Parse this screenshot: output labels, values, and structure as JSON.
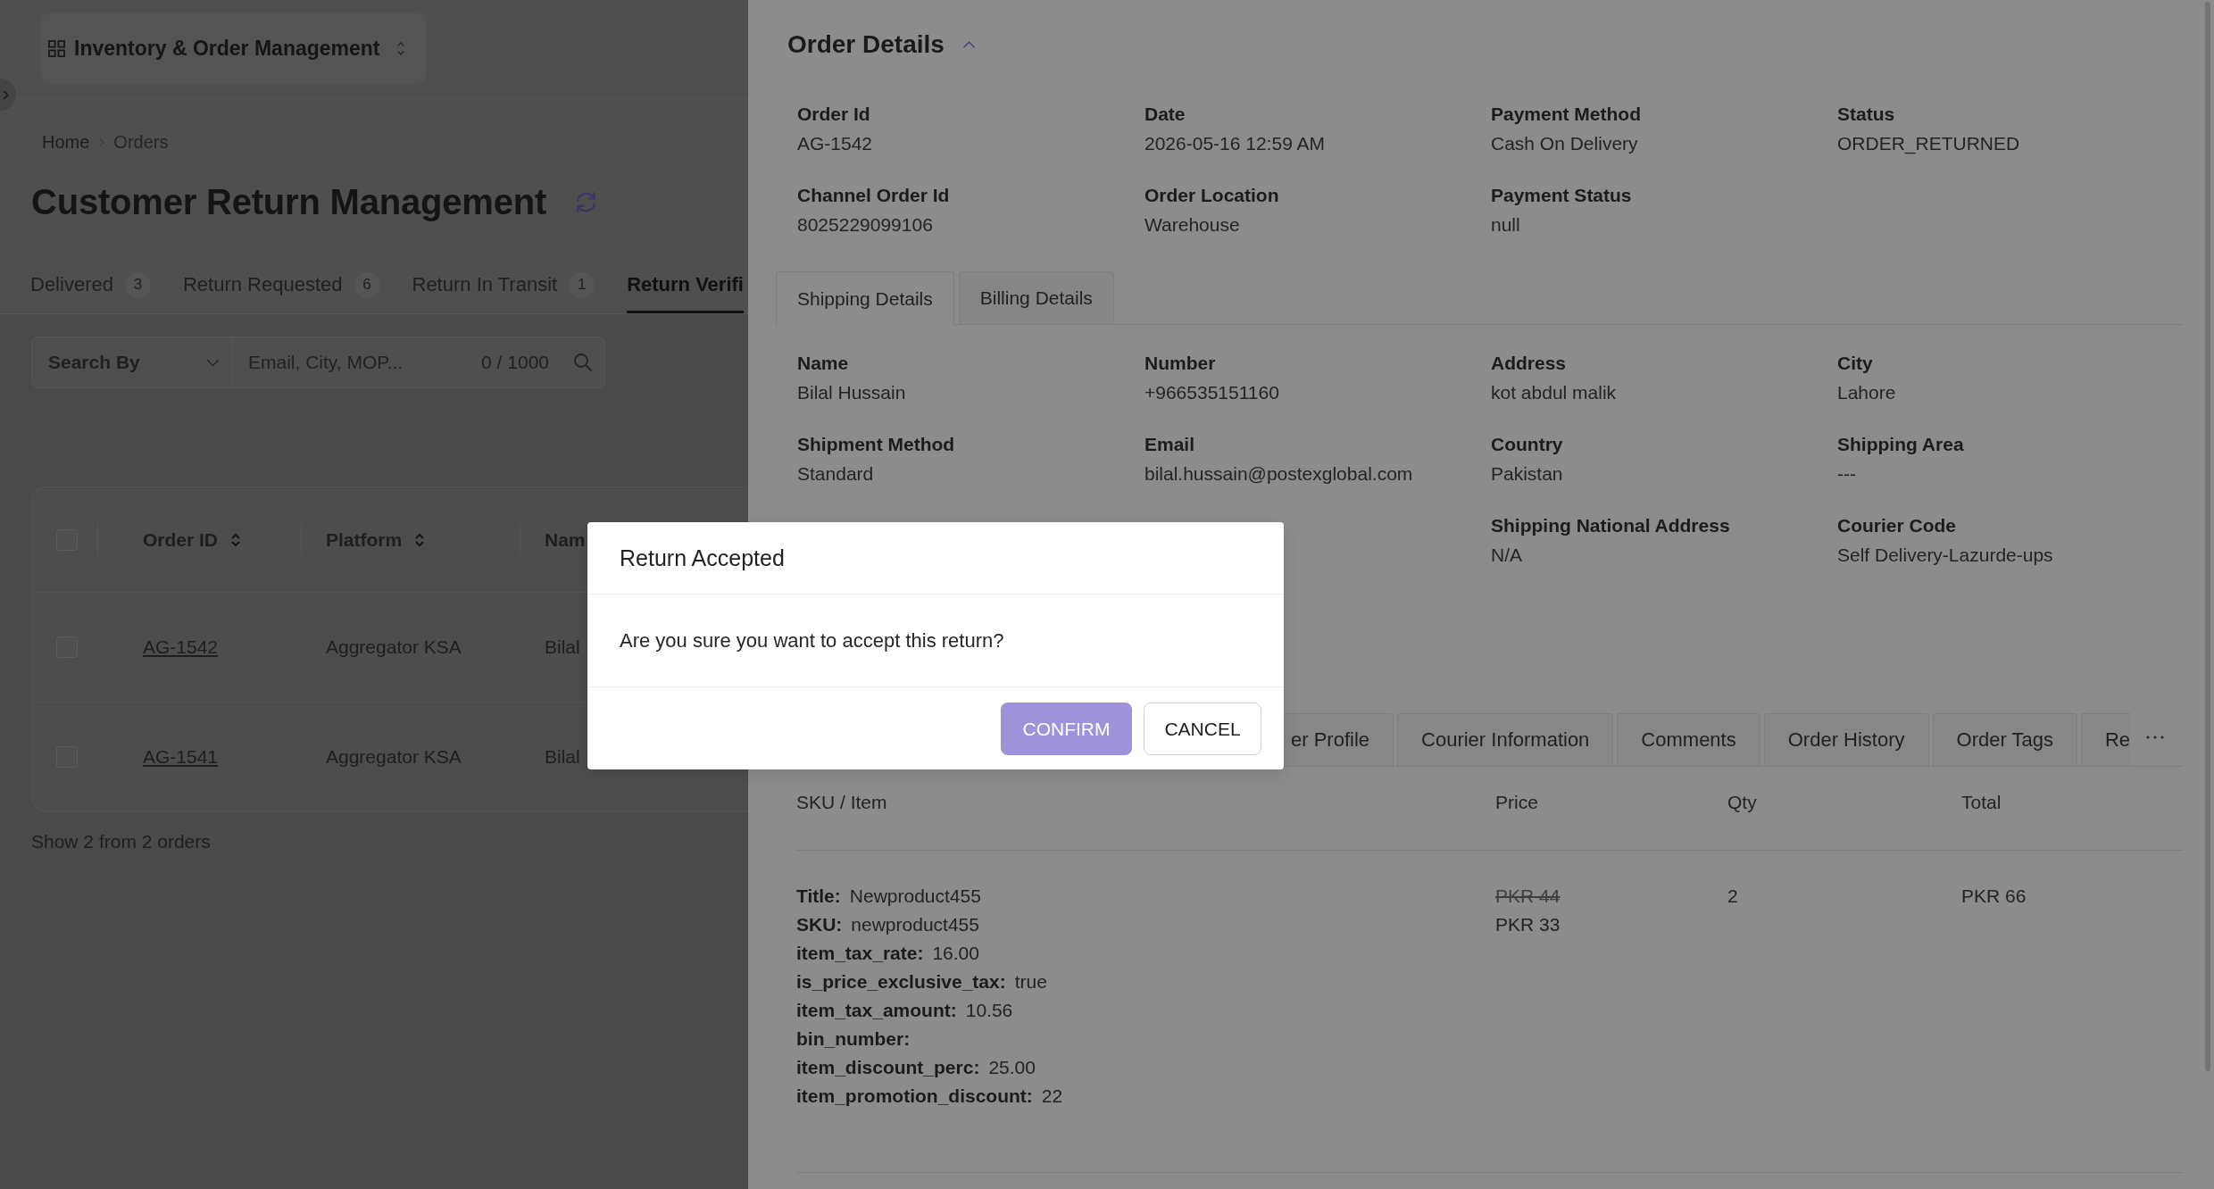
{
  "app_switcher": {
    "label": "Inventory & Order Management"
  },
  "breadcrumb": [
    {
      "label": "Home"
    },
    {
      "label": "Orders"
    }
  ],
  "page_title": "Customer Return Management",
  "status_tabs": [
    {
      "label": "Delivered",
      "count": "3",
      "selected": false
    },
    {
      "label": "Return Requested",
      "count": "6",
      "selected": false
    },
    {
      "label": "Return In Transit",
      "count": "1",
      "selected": false
    },
    {
      "label": "Return Verifi",
      "selected": true
    }
  ],
  "search": {
    "select": {
      "placeholder": "Search By"
    },
    "placeholder": "Email, City, MOP...",
    "counter": "0 / 1000"
  },
  "orders_table": {
    "select_all": {
      "checked": false
    },
    "columns": [
      {
        "label": "Order ID",
        "kind": "link",
        "sortable": true
      },
      {
        "label": "Platform",
        "kind": "text",
        "sortable": true
      },
      {
        "label": "Nam",
        "kind": "text"
      }
    ],
    "rows": [
      {
        "checked": false,
        "cells": [
          "AG-1542",
          "Aggregator KSA",
          "Bilal"
        ]
      },
      {
        "checked": false,
        "cells": [
          "AG-1541",
          "Aggregator KSA",
          "Bilal"
        ]
      }
    ]
  },
  "table_footer": "Show 2 from 2 orders",
  "order_details": {
    "title": "Order Details",
    "expanded": true,
    "columns": [
      [
        {
          "label": "Order Id",
          "value": "AG-1542"
        },
        {
          "label": "Channel Order Id",
          "value": "8025229099106"
        }
      ],
      [
        {
          "label": "Date",
          "value": "2026-05-16 12:59 AM"
        },
        {
          "label": "Order Location",
          "value": "Warehouse"
        }
      ],
      [
        {
          "label": "Payment Method",
          "value": "Cash On Delivery"
        },
        {
          "label": "Payment Status",
          "value": "null"
        }
      ],
      [
        {
          "label": "Status",
          "value": "ORDER_RETURNED"
        }
      ]
    ]
  },
  "shipping": {
    "tabs": [
      {
        "label": "Shipping Details",
        "selected": true
      },
      {
        "label": "Billing Details",
        "selected": false
      }
    ],
    "columns": [
      [
        {
          "label": "Name",
          "value": "Bilal Hussain"
        },
        {
          "label": "Shipment Method",
          "value": "Standard"
        }
      ],
      [
        {
          "label": "Number",
          "value": "+966535151160"
        },
        {
          "label": "Email",
          "value": "bilal.hussain@postexglobal.com"
        }
      ],
      [
        {
          "label": "Address",
          "value": "kot abdul malik"
        },
        {
          "label": "Country",
          "value": "Pakistan"
        },
        {
          "label": "Shipping National Address",
          "value": "N/A"
        }
      ],
      [
        {
          "label": "City",
          "value": "Lahore"
        },
        {
          "label": "Shipping Area",
          "value": "---"
        },
        {
          "label": "Courier Code",
          "value": "Self Delivery-Lazurde-ups"
        }
      ]
    ]
  },
  "detail_tabs": [
    {
      "label": "er Profile",
      "selected": false
    },
    {
      "label": "Courier Information",
      "selected": false
    },
    {
      "label": "Comments",
      "selected": false
    },
    {
      "label": "Order History",
      "selected": false
    },
    {
      "label": "Order Tags",
      "selected": false
    },
    {
      "label": "Re",
      "selected": false
    }
  ],
  "items_table": {
    "columns": [
      "SKU / Item",
      "Price",
      "Qty",
      "Total"
    ],
    "rows": [
      {
        "attributes": [
          {
            "label": "Title:",
            "value": "Newproduct455"
          },
          {
            "label": "SKU:",
            "value": "newproduct455"
          },
          {
            "label": "item_tax_rate:",
            "value": "16.00"
          },
          {
            "label": "is_price_exclusive_tax:",
            "value": "true"
          },
          {
            "label": "item_tax_amount:",
            "value": "10.56"
          },
          {
            "label": "bin_number:"
          },
          {
            "label": "item_discount_perc:",
            "value": "25.00"
          },
          {
            "label": "item_promotion_discount:",
            "value": "22"
          }
        ],
        "original_price": "PKR 44",
        "price": "PKR 33",
        "qty": "2",
        "total": "PKR 66"
      }
    ]
  },
  "dialog": {
    "title": "Return Accepted",
    "message": "Are you sure you want to accept this return?",
    "buttons": [
      {
        "label": "CONFIRM",
        "kind": "primary"
      },
      {
        "label": "CANCEL",
        "kind": "secondary"
      }
    ]
  }
}
